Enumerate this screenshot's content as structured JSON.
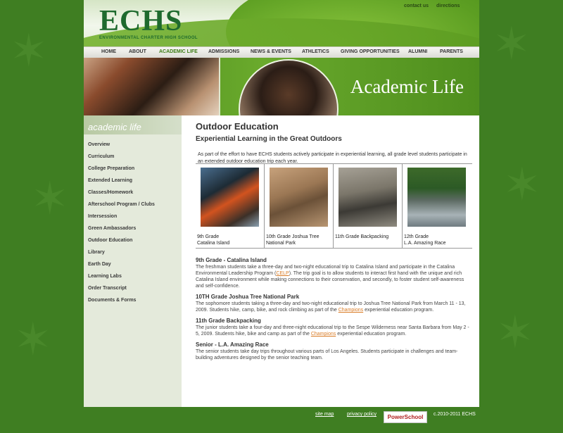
{
  "header": {
    "logo_text": "ECHS",
    "logo_subtitle": "ENVIRONMENTAL CHARTER HIGH SCHOOL",
    "top_links": [
      "contact us",
      "directions"
    ]
  },
  "nav": {
    "items": [
      "HOME",
      "ABOUT",
      "ACADEMIC LIFE",
      "ADMISSIONS",
      "NEWS & EVENTS",
      "ATHLETICS",
      "GIVING OPPORTUNITIES",
      "ALUMNI",
      "PARENTS"
    ],
    "active": "ACADEMIC LIFE"
  },
  "banner": {
    "title": "Academic Life"
  },
  "sidebar": {
    "header": "academic life",
    "items": [
      "Overview",
      "Curriculum",
      "College Preparation",
      "Extended Learning",
      "Classes/Homework",
      "Afterschool Program / Clubs",
      "Intersession",
      "Green Ambassadors",
      "Outdoor Education",
      "Library",
      "Earth Day",
      "Learning Labs",
      "Order Transcript",
      "Documents & Forms"
    ]
  },
  "main": {
    "title": "Outdoor Education",
    "subtitle": "Experiential Learning in the Great Outdoors",
    "intro": "As part of the effort to have ECHS students actively participate in experiential learning, all grade level students participate in an extended outdoor education trip each year.",
    "photos": [
      {
        "caption_line1": "9th Grade",
        "caption_line2": "Catalina Island"
      },
      {
        "caption_line1": "10th Grade Joshua Tree",
        "caption_line2": "National Park"
      },
      {
        "caption_line1": "11th Grade Backpacking",
        "caption_line2": ""
      },
      {
        "caption_line1": "12th Grade",
        "caption_line2": "L.A. Amazing Race"
      }
    ],
    "sections": [
      {
        "heading": "9th Grade - Catalina Island",
        "text_before": "The freshman students take a three-day and two-night educational trip to Catalina Island and participate in the Catalina Environmental Leadership Program (",
        "link": "CELP",
        "text_after": "). The trip goal is to allow students to interact first hand with the unique and rich Catalina Island environment while making connections to their conservation, and secondly, to foster student self-awareness and self-confidence."
      },
      {
        "heading": "10TH Grade Joshua Tree National Park",
        "text_before": "The sophomore students taking a three-day and two-night educational trip to Joshua Tree National Park from March 11 - 13, 2009.  Students hike, camp, bike, and rock climbing as part of the ",
        "link": "Champions",
        "text_after": " experiential education program."
      },
      {
        "heading": "11th Grade Backpacking",
        "text_before": "The junior students take a four-day and three-night educational trip to the Sespe Wilderness near Santa Barbara from May 2 - 5, 2009.  Students hike, bike and camp as part of the ",
        "link": "Champions",
        "text_after": " experiential education program."
      },
      {
        "heading": "Senior - L.A. Amazing Race",
        "text_before": "The senior students take day trips throughout various parts of Los Angeles.   Students participate in challenges and team-building adventures designed by the senior teaching team.",
        "link": "",
        "text_after": ""
      }
    ]
  },
  "footer": {
    "links": [
      "site map",
      "privacy policy"
    ],
    "badge": "PowerSchool",
    "copyright": "c.2010-2011 ECHS"
  },
  "colors": {
    "background": "#3f7e22",
    "brand_green": "#1e6a2e",
    "nav_active": "#3a7a12",
    "link_orange": "#d97b25"
  }
}
